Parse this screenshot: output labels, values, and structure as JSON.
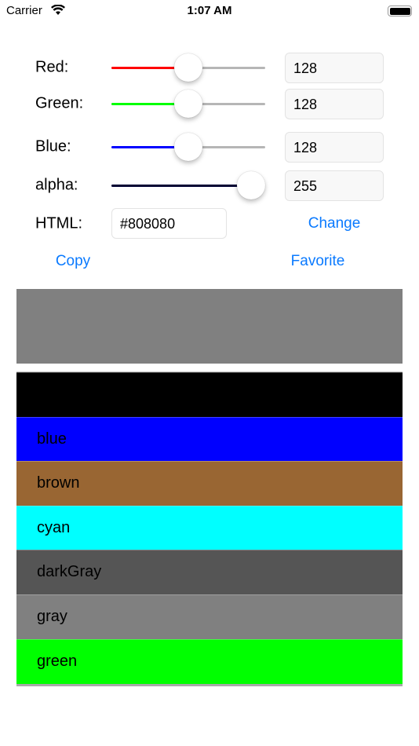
{
  "status_bar": {
    "carrier": "Carrier",
    "time": "1:07 AM"
  },
  "controls": {
    "red": {
      "label": "Red:",
      "value": "128",
      "level": 128,
      "color": "#ff0000"
    },
    "green": {
      "label": "Green:",
      "value": "128",
      "level": 128,
      "color": "#00ff00"
    },
    "blue": {
      "label": "Blue:",
      "value": "128",
      "level": 128,
      "color": "#0000ff"
    },
    "alpha": {
      "label": "alpha:",
      "value": "255",
      "level": 255,
      "color": "#000033"
    }
  },
  "html": {
    "label": "HTML:",
    "value": "#808080",
    "change_label": "Change"
  },
  "actions": {
    "copy_label": "Copy",
    "favorite_label": "Favorite"
  },
  "preview_color": "#808080",
  "colors": [
    {
      "name": "",
      "hex": "#000000"
    },
    {
      "name": "blue",
      "hex": "#0000ff"
    },
    {
      "name": "brown",
      "hex": "#996633"
    },
    {
      "name": "cyan",
      "hex": "#00ffff"
    },
    {
      "name": "darkGray",
      "hex": "#555555"
    },
    {
      "name": "gray",
      "hex": "#808080"
    },
    {
      "name": "green",
      "hex": "#00ff00"
    }
  ]
}
